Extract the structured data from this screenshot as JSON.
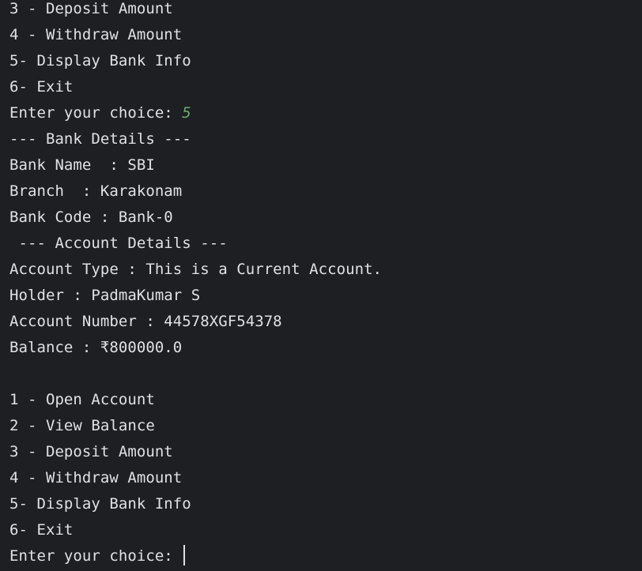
{
  "console": {
    "menu_top": [
      "3 - Deposit Amount",
      "4 - Withdraw Amount",
      "5- Display Bank Info",
      "6- Exit"
    ],
    "prompt_1": "Enter your choice: ",
    "input_1": "5",
    "bank_header": "--- Bank Details ---",
    "bank_name_line": "Bank Name  : SBI",
    "branch_line": "Branch  : Karakonam",
    "bank_code_line": "Bank Code : Bank-0",
    "account_header": " --- Account Details ---",
    "account_type_line": "Account Type : This is a Current Account.",
    "holder_line": "Holder : PadmaKumar S",
    "account_number_line": "Account Number : 44578XGF54378",
    "balance_line": "Balance : ₹800000.0",
    "menu_bottom": [
      "1 - Open Account",
      "2 - View Balance",
      "3 - Deposit Amount",
      "4 - Withdraw Amount",
      "5- Display Bank Info",
      "6- Exit"
    ],
    "prompt_2": "Enter your choice: "
  },
  "colors": {
    "background": "#1e1f22",
    "text": "#dfe1e5",
    "user_input": "#6aab73"
  }
}
